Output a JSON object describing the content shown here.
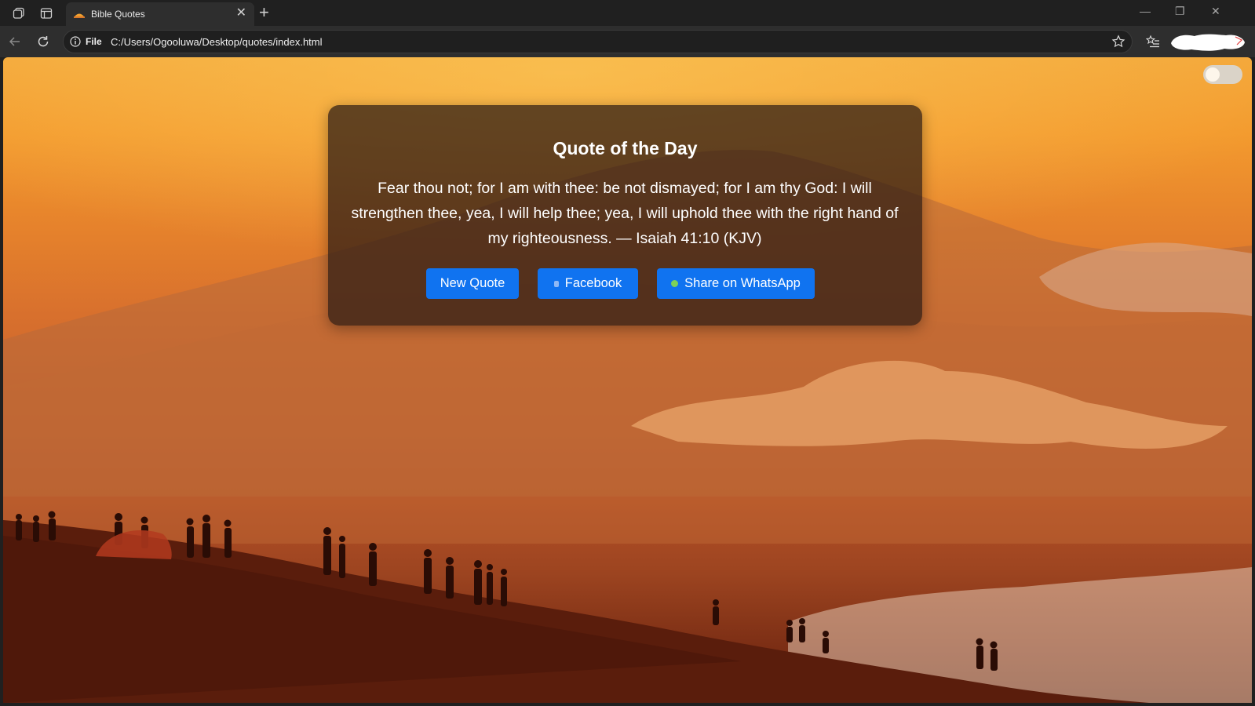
{
  "browser": {
    "tab_title": "Bible Quotes",
    "address_scheme": "File",
    "address_url": "C:/Users/Ogooluwa/Desktop/quotes/index.html",
    "icons": {
      "workspaces": "workspaces-icon",
      "vertical_tabs": "vertical-tabs-icon",
      "new_tab": "plus-icon",
      "close_tab": "close-icon",
      "back": "back-arrow-icon",
      "refresh": "refresh-icon",
      "site_info": "info-icon",
      "favorite": "star-icon",
      "favorites_list": "favorites-list-icon",
      "minimize": "minimize-icon",
      "restore": "restore-icon",
      "close_window": "close-window-icon"
    }
  },
  "page": {
    "theme_toggle": {
      "state": "off"
    },
    "card": {
      "title": "Quote of the Day",
      "quote": "Fear thou not; for I am with thee: be not dismayed; for I am thy God: I will strengthen thee, yea, I will help thee; yea, I will uphold thee with the right hand of my righteousness. — Isaiah 41:10 (KJV)"
    },
    "buttons": {
      "new_quote": "New Quote",
      "facebook": "Facebook",
      "whatsapp": "Share on WhatsApp"
    },
    "colors": {
      "button_blue": "#1073f0",
      "card_bg": "rgba(40,25,20,0.72)",
      "sky_top": "#f3a73a",
      "ground": "#5e200e"
    }
  }
}
